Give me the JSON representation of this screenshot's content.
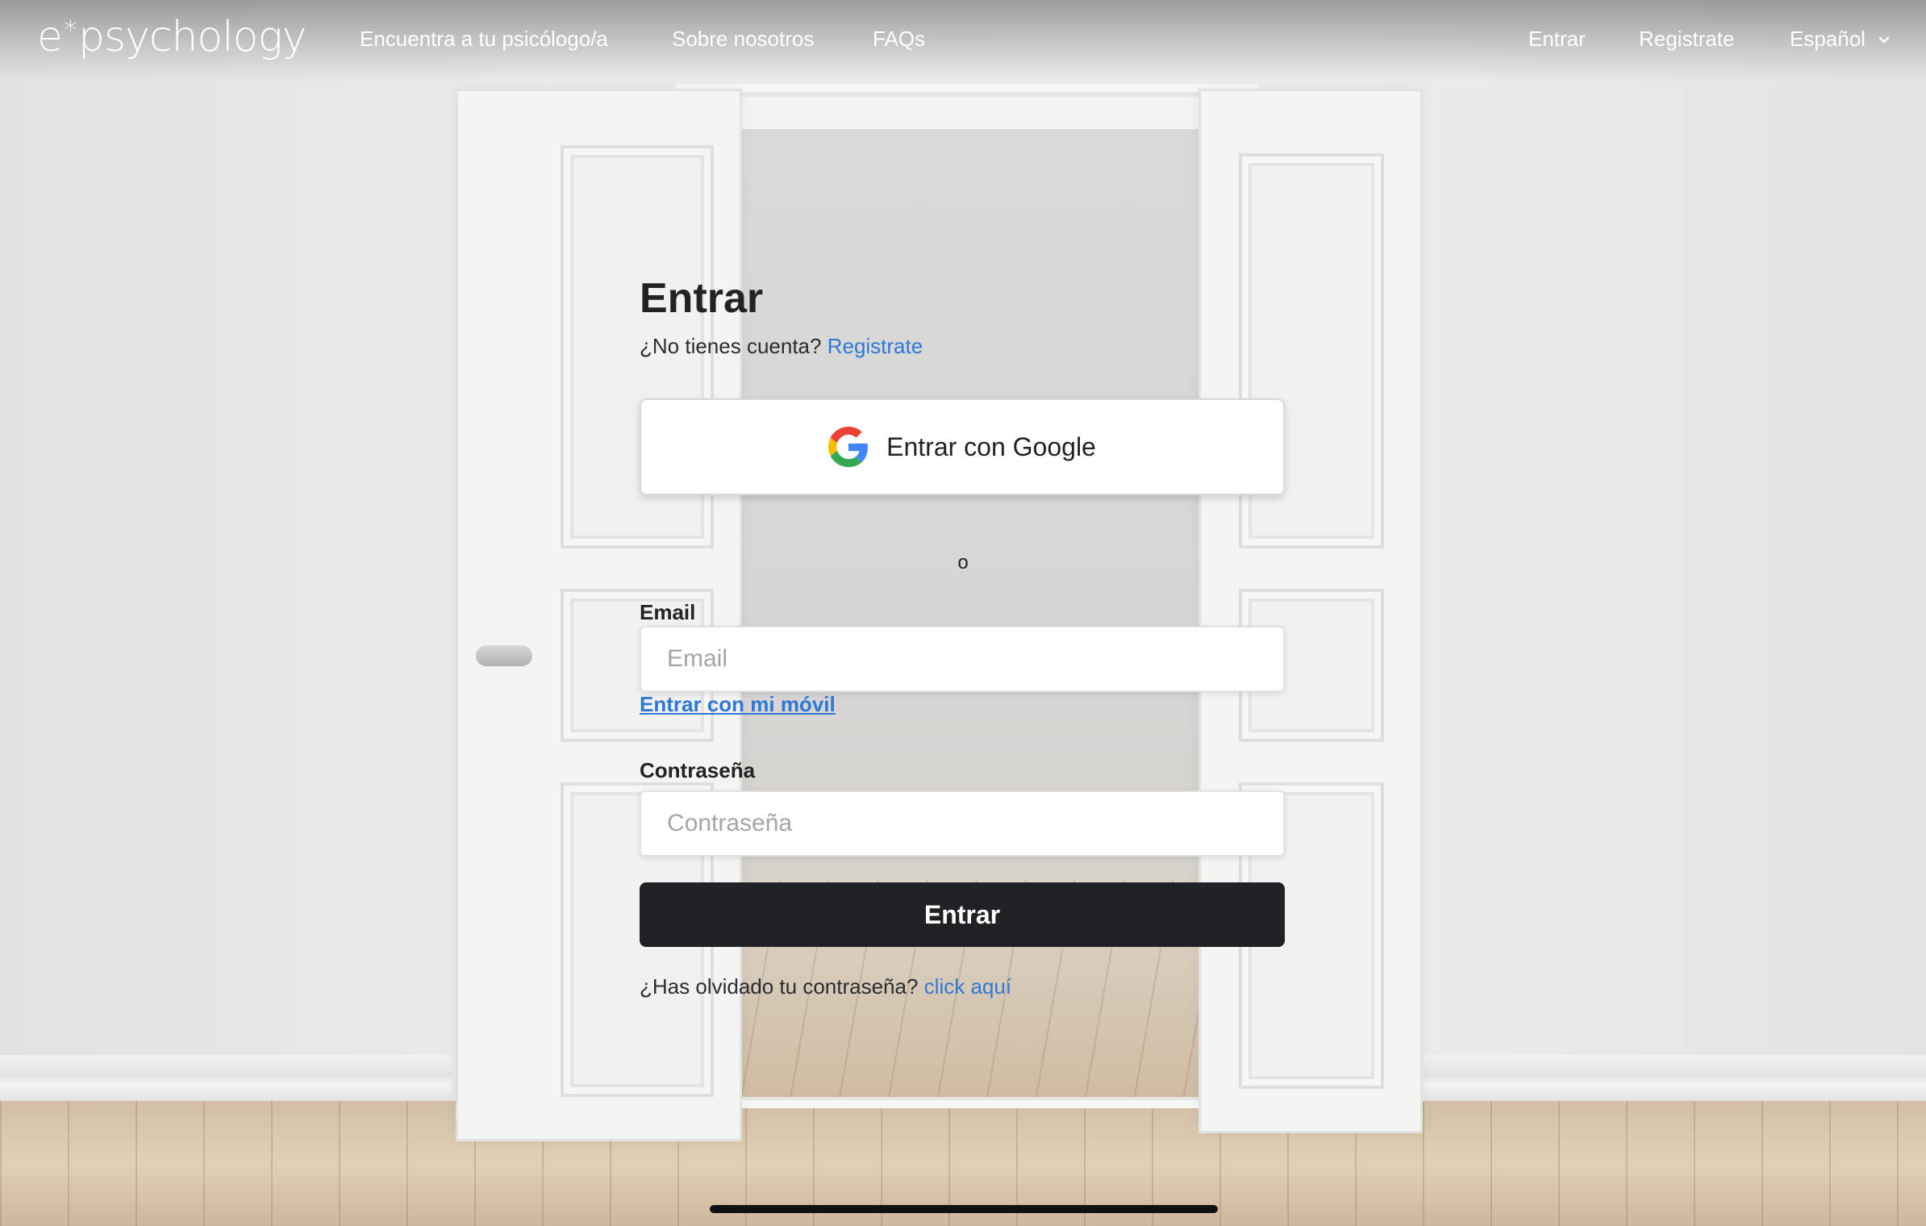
{
  "header": {
    "logo": {
      "prefix": "e",
      "symbol": "*",
      "suffix": "psychology"
    },
    "nav": {
      "find_psychologist": "Encuentra a tu psicólogo/a",
      "about": "Sobre nosotros",
      "faqs": "FAQs",
      "login": "Entrar",
      "register": "Registrate",
      "language": "Español"
    }
  },
  "login": {
    "title": "Entrar",
    "no_account_text": "¿No tienes cuenta?",
    "register_link": "Registrate",
    "google_button": "Entrar con Google",
    "or_separator": "o",
    "email": {
      "label": "Email",
      "placeholder": "Email",
      "value": ""
    },
    "mobile_login_link": "Entrar con mi móvil",
    "password": {
      "label": "Contraseña",
      "placeholder": "Contraseña",
      "value": ""
    },
    "submit_button": "Entrar",
    "forgot_text": "¿Has olvidado tu contraseña?",
    "forgot_link": "click aquí"
  },
  "colors": {
    "link": "#2f78d8",
    "primary_button": "#1f2124",
    "text": "#212326"
  },
  "icons": [
    "google-icon",
    "chevron-down-icon"
  ]
}
